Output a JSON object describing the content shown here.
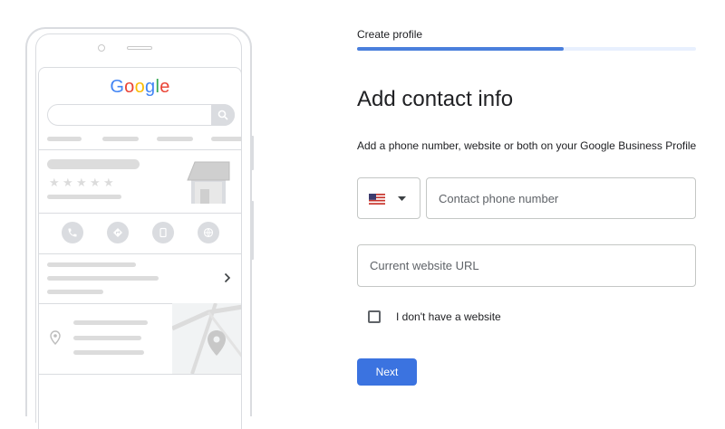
{
  "header": {
    "step_label": "Create profile",
    "progress": 0.61
  },
  "main": {
    "title": "Add contact info",
    "description": "Add a phone number, website or both on your Google Business Profile",
    "phone_country": {
      "flag_icon": "us-flag-icon",
      "chevron_icon": "arrow-drop-down-icon"
    },
    "phone_field": {
      "value": "",
      "placeholder": "Contact phone number"
    },
    "website_field": {
      "value": "",
      "placeholder": "Current website URL"
    },
    "no_website_checkbox": {
      "checked": false,
      "label": "I don't have a website"
    },
    "next_button": "Next"
  },
  "illustration": {
    "logo_letters": [
      {
        "char": "G",
        "color": "#4285f4"
      },
      {
        "char": "o",
        "color": "#ea4335"
      },
      {
        "char": "o",
        "color": "#fbbc05"
      },
      {
        "char": "g",
        "color": "#4285f4"
      },
      {
        "char": "l",
        "color": "#34a853"
      },
      {
        "char": "e",
        "color": "#ea4335"
      }
    ],
    "icons": [
      "search-icon",
      "storefront-icon",
      "phone-icon",
      "directions-icon",
      "bookmark-icon",
      "globe-icon",
      "chevron-right-icon",
      "location-pin-icon"
    ]
  },
  "colors": {
    "accent": "#3b73e0",
    "progress_track": "#e8f0fe",
    "placeholder_gray": "#dcdcdc"
  }
}
